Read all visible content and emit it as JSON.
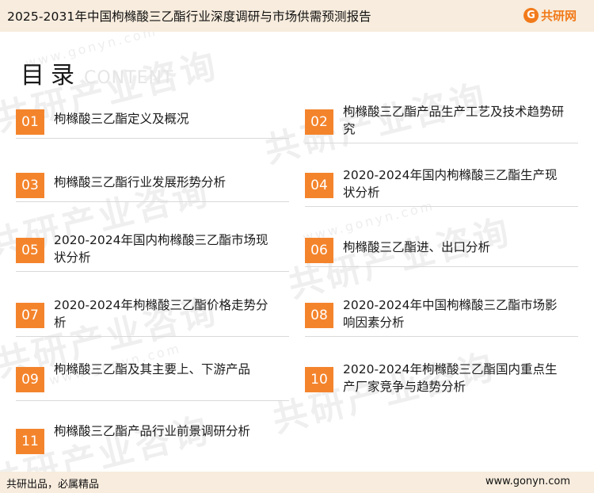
{
  "header": {
    "title": "2025-2031年中国枸橼酸三乙酯行业深度调研与市场供需预测报告",
    "logo_mark": "G",
    "logo_text": "共研网"
  },
  "watermark": {
    "text": "共研产业咨询",
    "url": "www.gonyn.com"
  },
  "toc": {
    "heading": "目录",
    "heading_en": "CONTENT",
    "items": [
      {
        "num": "01",
        "text": "枸橼酸三乙酯定义及概况"
      },
      {
        "num": "02",
        "text": "枸橼酸三乙酯产品生产工艺及技术趋势研究"
      },
      {
        "num": "03",
        "text": "枸橼酸三乙酯行业发展形势分析"
      },
      {
        "num": "04",
        "text": "2020-2024年国内枸橼酸三乙酯生产现状分析"
      },
      {
        "num": "05",
        "text": "2020-2024年国内枸橼酸三乙酯市场现状分析"
      },
      {
        "num": "06",
        "text": "枸橼酸三乙酯进、出口分析"
      },
      {
        "num": "07",
        "text": "2020-2024年枸橼酸三乙酯价格走势分析"
      },
      {
        "num": "08",
        "text": "2020-2024年中国枸橼酸三乙酯市场影响因素分析"
      },
      {
        "num": "09",
        "text": "枸橼酸三乙酯及其主要上、下游产品"
      },
      {
        "num": "10",
        "text": "2020-2024年枸橼酸三乙酯国内重点生产厂家竞争与趋势分析"
      },
      {
        "num": "11",
        "text": "枸橼酸三乙酯产品行业前景调研分析"
      }
    ]
  },
  "footer": {
    "slogan": "共研出品，必属精品",
    "url": "www.gonyn.com"
  },
  "colors": {
    "accent": "#f4842c",
    "header_bg": "#f7ecdd",
    "logo": "#f27a1a"
  }
}
